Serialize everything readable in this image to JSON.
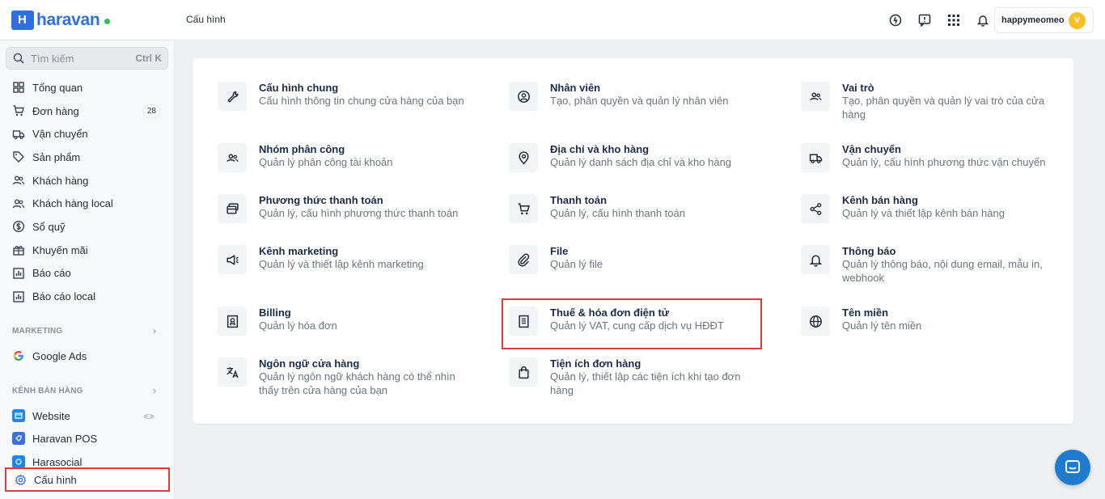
{
  "header": {
    "brand": "haravan",
    "page_title": "Cấu hình",
    "user_name": "happymeomeo",
    "user_initial": "V"
  },
  "sidebar": {
    "search_placeholder": "Tìm kiếm",
    "search_shortcut": "Ctrl K",
    "items": [
      {
        "label": "Tổng quan",
        "icon": "dashboard-icon"
      },
      {
        "label": "Đơn hàng",
        "icon": "cart-icon",
        "badge": "28"
      },
      {
        "label": "Vận chuyển",
        "icon": "truck-icon"
      },
      {
        "label": "Sản phẩm",
        "icon": "tag-icon"
      },
      {
        "label": "Khách hàng",
        "icon": "users-icon"
      },
      {
        "label": "Khách hàng local",
        "icon": "users-icon"
      },
      {
        "label": "Sổ quỹ",
        "icon": "dollar-icon"
      },
      {
        "label": "Khuyến mãi",
        "icon": "gift-icon"
      },
      {
        "label": "Báo cáo",
        "icon": "chart-icon"
      },
      {
        "label": "Báo cáo local",
        "icon": "chart-icon"
      }
    ],
    "marketing_heading": "MARKETING",
    "marketing_items": [
      {
        "label": "Google Ads",
        "icon": "google-icon"
      }
    ],
    "channels_heading": "KÊNH BÁN HÀNG",
    "channel_items": [
      {
        "label": "Website",
        "icon": "website-icon"
      },
      {
        "label": "Haravan POS",
        "icon": "pos-icon"
      },
      {
        "label": "Harasocial",
        "icon": "social-icon"
      }
    ],
    "active_item": "Cấu hình"
  },
  "settings": [
    {
      "title": "Cấu hình chung",
      "desc": "Cấu hình thông tin chung cửa hàng của bạn",
      "icon": "wrench-icon"
    },
    {
      "title": "Nhân viên",
      "desc": "Tạo, phân quyền và quản lý nhân viên",
      "icon": "user-circle-icon"
    },
    {
      "title": "Vai trò",
      "desc": "Tạo, phân quyền và quản lý vai trò của cửa hàng",
      "icon": "users-icon"
    },
    {
      "title": "Nhóm phân công",
      "desc": "Quản lý phân công tài khoản",
      "icon": "users-icon"
    },
    {
      "title": "Địa chỉ và kho hàng",
      "desc": "Quản lý danh sách địa chỉ và kho hàng",
      "icon": "pin-icon"
    },
    {
      "title": "Vận chuyển",
      "desc": "Quản lý, cấu hình phương thức vận chuyển",
      "icon": "truck-icon"
    },
    {
      "title": "Phương thức thanh toán",
      "desc": "Quản lý, cấu hình phương thức thanh toán",
      "icon": "cards-icon"
    },
    {
      "title": "Thanh toán",
      "desc": "Quản lý, cấu hình thanh toán",
      "icon": "cart-icon"
    },
    {
      "title": "Kênh bán hàng",
      "desc": "Quản lý và thiết lập kênh bán hàng",
      "icon": "share-icon"
    },
    {
      "title": "Kênh marketing",
      "desc": "Quản lý và thiết lập kênh marketing",
      "icon": "megaphone-icon"
    },
    {
      "title": "File",
      "desc": "Quản lý file",
      "icon": "paperclip-icon"
    },
    {
      "title": "Thông báo",
      "desc": "Quản lý thông báo, nội dung email, mẫu in, webhook",
      "icon": "bell-icon"
    },
    {
      "title": "Billing",
      "desc": "Quản lý hóa đơn",
      "icon": "receipt-icon"
    },
    {
      "title": "Thuế & hóa đơn điện tử",
      "desc": "Quản lý VAT, cung cấp dịch vụ HĐĐT",
      "icon": "invoice-icon"
    },
    {
      "title": "Tên miền",
      "desc": "Quản lý tên miền",
      "icon": "globe-icon"
    },
    {
      "title": "Ngôn ngữ cửa hàng",
      "desc": "Quản lý ngôn ngữ khách hàng có thể nhìn thấy trên cửa hàng của bạn",
      "icon": "translate-icon"
    },
    {
      "title": "Tiện ích đơn hàng",
      "desc": "Quản lý, thiết lập các tiện ích khi tạo đơn hàng",
      "icon": "bag-icon"
    }
  ],
  "colors": {
    "brand": "#2f6fe0",
    "highlight": "#e03a3a",
    "title": "#1a2b4a",
    "desc": "#6b7280"
  }
}
